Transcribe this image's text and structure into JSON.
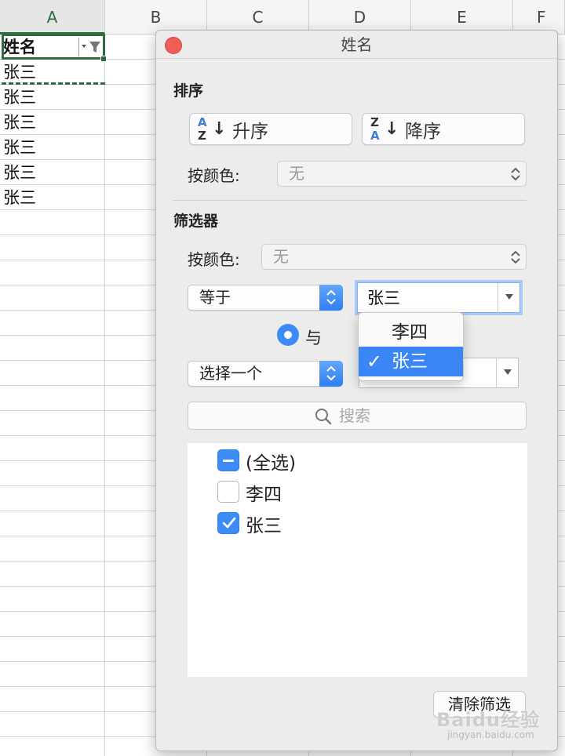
{
  "sheet": {
    "columns": [
      "A",
      "B",
      "C",
      "D",
      "E",
      "F"
    ],
    "active_column": "A",
    "header_cell": "姓名",
    "rows": [
      "张三",
      "张三",
      "张三",
      "张三",
      "张三",
      "张三"
    ]
  },
  "popover": {
    "title": "姓名",
    "sort": {
      "section_title": "排序",
      "ascending_label": "升序",
      "descending_label": "降序",
      "ascending_icon_letters": [
        "A",
        "Z"
      ],
      "descending_icon_letters": [
        "Z",
        "A"
      ],
      "by_color_label": "按颜色:",
      "by_color_value": "无"
    },
    "filter": {
      "section_title": "筛选器",
      "by_color_label": "按颜色:",
      "by_color_value": "无",
      "condition1_operator": "等于",
      "condition1_value": "张三",
      "logic_label": "与",
      "condition2_operator": "选择一个",
      "condition2_value": "",
      "dropdown_options": [
        {
          "label": "李四",
          "selected": false
        },
        {
          "label": "张三",
          "selected": true
        }
      ],
      "search_placeholder": "搜索",
      "checklist": [
        {
          "label": "(全选)",
          "state": "mixed"
        },
        {
          "label": "李四",
          "state": "unchecked"
        },
        {
          "label": "张三",
          "state": "checked"
        }
      ],
      "clear_button": "清除筛选"
    }
  },
  "watermark": {
    "main": "Baidu经验",
    "sub": "jingyan.baidu.com"
  },
  "colors": {
    "excel_green": "#2e6b3d",
    "accent_blue": "#3d8bf7",
    "close_red": "#ee5e57"
  }
}
